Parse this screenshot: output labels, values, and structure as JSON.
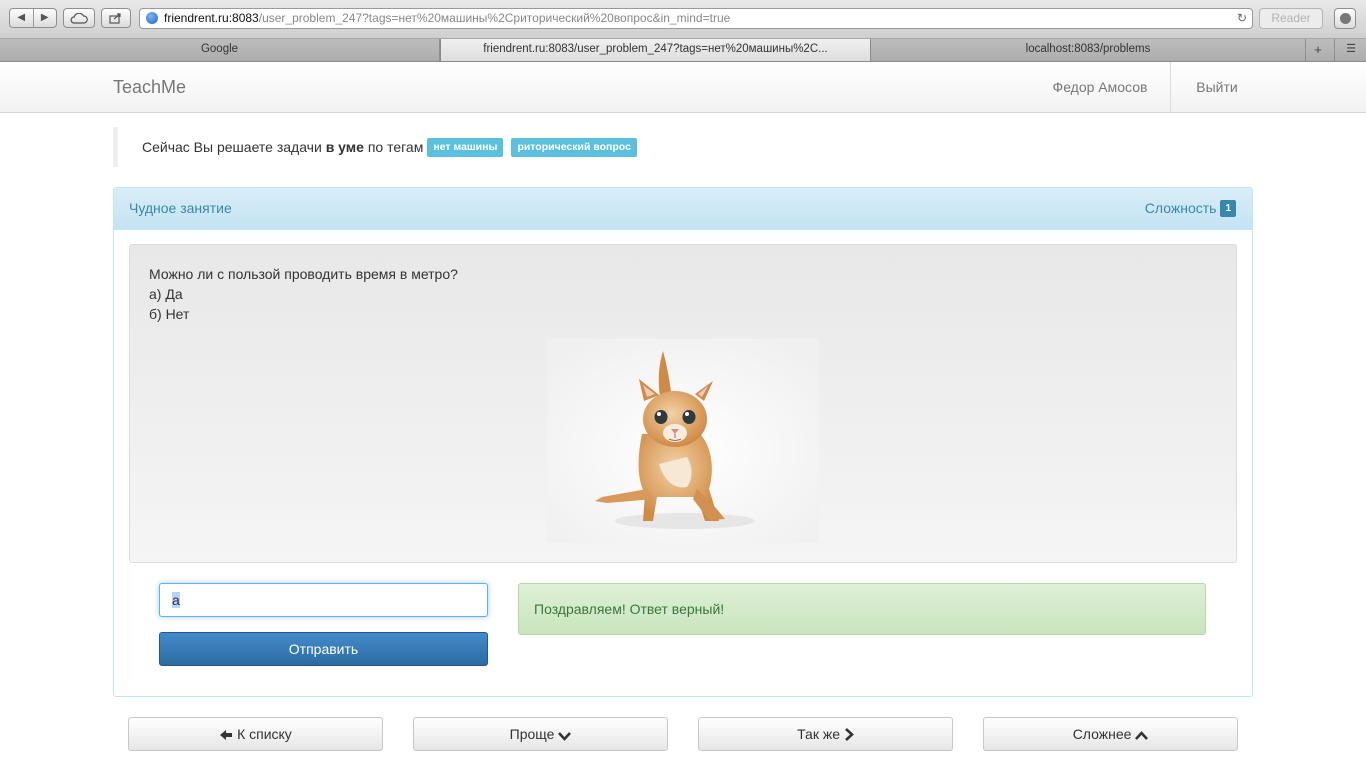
{
  "browser": {
    "url_host": "friendrent.ru:8083",
    "url_path": "/user_problem_247?tags=нет%20машины%2Cриторический%20вопрос&in_mind=true",
    "reader_label": "Reader",
    "tabs": [
      {
        "label": "Google"
      },
      {
        "label": "friendrent.ru:8083/user_problem_247?tags=нет%20машины%2C..."
      },
      {
        "label": "localhost:8083/problems"
      }
    ]
  },
  "navbar": {
    "brand": "TeachMe",
    "user": "Федор Амосов",
    "logout": "Выйти"
  },
  "notice": {
    "prefix": "Сейчас Вы решаете задачи",
    "mode": "в уме",
    "suffix": "по тегам",
    "tags": [
      "нет машины",
      "риторический вопрос"
    ]
  },
  "problem": {
    "title": "Чудное занятие",
    "difficulty_label": "Сложность",
    "difficulty": "1",
    "question": "Можно ли с пользой проводить время в метро?",
    "options": [
      "а) Да",
      "б) Нет"
    ],
    "image_name": "kitten-image",
    "answer_value": "а",
    "submit_label": "Отправить",
    "result": "Поздравляем! Ответ верный!"
  },
  "footer": {
    "back": "К списку",
    "easier": "Проще",
    "same": "Так же",
    "harder": "Сложнее"
  },
  "colors": {
    "info": "#3a87ad",
    "label": "#5bc0de",
    "primary": "#428bca",
    "success_text": "#3c763d"
  }
}
